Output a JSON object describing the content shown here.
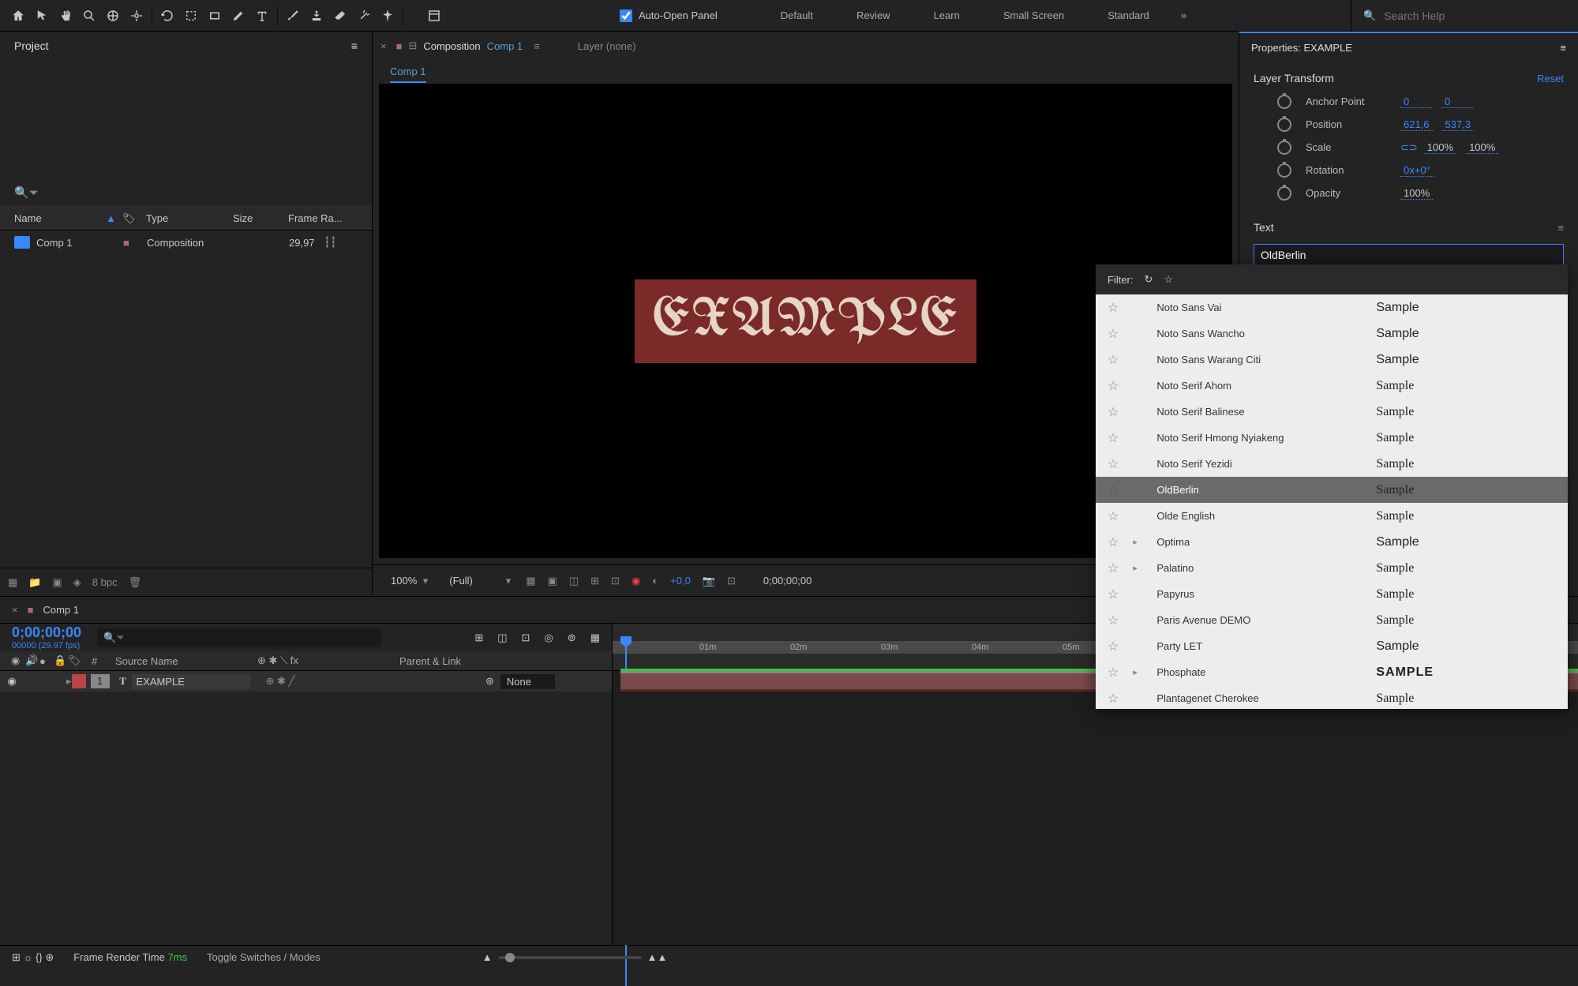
{
  "toolbar": {
    "auto_open": "Auto-Open Panel",
    "workspaces": [
      "Default",
      "Review",
      "Learn",
      "Small Screen",
      "Standard"
    ],
    "search_placeholder": "Search Help"
  },
  "project": {
    "panel": "Project",
    "cols": {
      "name": "Name",
      "type": "Type",
      "size": "Size",
      "fr": "Frame Ra..."
    },
    "item": {
      "name": "Comp 1",
      "type": "Composition",
      "fr": "29,97"
    },
    "bpc": "8 bpc"
  },
  "comp": {
    "title": "Composition",
    "name": "Comp 1",
    "layer_none": "Layer (none)",
    "tab": "Comp 1",
    "text": "EXAMPLE",
    "zoom": "100%",
    "res": "(Full)",
    "exposure": "+0,0",
    "timecode": "0;00;00;00"
  },
  "props": {
    "title": "Properties: EXAMPLE",
    "section": "Layer Transform",
    "reset": "Reset",
    "anchor": {
      "label": "Anchor Point",
      "x": "0",
      "y": "0"
    },
    "position": {
      "label": "Position",
      "x": "621,6",
      "y": "537,3"
    },
    "scale": {
      "label": "Scale",
      "x": "100",
      "y": "100",
      "pct": "%"
    },
    "rotation": {
      "label": "Rotation",
      "v": "0x+0°"
    },
    "opacity": {
      "label": "Opacity",
      "v": "100",
      "pct": "%"
    },
    "text_section": "Text",
    "font_value": "OldBerlin"
  },
  "timeline": {
    "tab": "Comp 1",
    "timecode": "0;00;00;00",
    "fps": "00000 (29.97 fps)",
    "cols": {
      "num": "#",
      "source": "Source Name",
      "switches": "⊕ ✱ ⟍ fx",
      "parent": "Parent & Link"
    },
    "layer": {
      "num": "1",
      "name": "EXAMPLE",
      "parent": "None"
    },
    "marks": [
      "01m",
      "02m",
      "03m",
      "04m",
      "05m"
    ],
    "frt_label": "Frame Render Time",
    "frt_val": "7ms",
    "toggle": "Toggle Switches / Modes"
  },
  "fonts": {
    "filter": "Filter:",
    "list": [
      {
        "name": "Noto Sans Vai",
        "sample": "Sample",
        "cls": ""
      },
      {
        "name": "Noto Sans Wancho",
        "sample": "Sample",
        "cls": ""
      },
      {
        "name": "Noto Sans Warang Citi",
        "sample": "Sample",
        "cls": ""
      },
      {
        "name": "Noto Serif Ahom",
        "sample": "Sample",
        "cls": "sample-serif"
      },
      {
        "name": "Noto Serif Balinese",
        "sample": "Sample",
        "cls": "sample-serif"
      },
      {
        "name": "Noto Serif Hmong Nyiakeng",
        "sample": "Sample",
        "cls": "sample-serif"
      },
      {
        "name": "Noto Serif Yezidi",
        "sample": "Sample",
        "cls": "sample-serif"
      },
      {
        "name": "OldBerlin",
        "sample": "Sample",
        "cls": "sample-black",
        "sel": true
      },
      {
        "name": "Olde English",
        "sample": "Sample",
        "cls": "sample-black"
      },
      {
        "name": "Optima",
        "sample": "Sample",
        "cls": "",
        "expand": true
      },
      {
        "name": "Palatino",
        "sample": "Sample",
        "cls": "sample-serif",
        "expand": true
      },
      {
        "name": "Papyrus",
        "sample": "Sample",
        "cls": "sample-papyrus"
      },
      {
        "name": "Paris Avenue DEMO",
        "sample": "Sample",
        "cls": "sample-serif"
      },
      {
        "name": "Party LET",
        "sample": "Sample",
        "cls": ""
      },
      {
        "name": "Phosphate",
        "sample": "SAMPLE",
        "cls": "sample-bold",
        "expand": true
      },
      {
        "name": "Plantagenet Cherokee",
        "sample": "Sample",
        "cls": "sample-serif"
      }
    ]
  }
}
